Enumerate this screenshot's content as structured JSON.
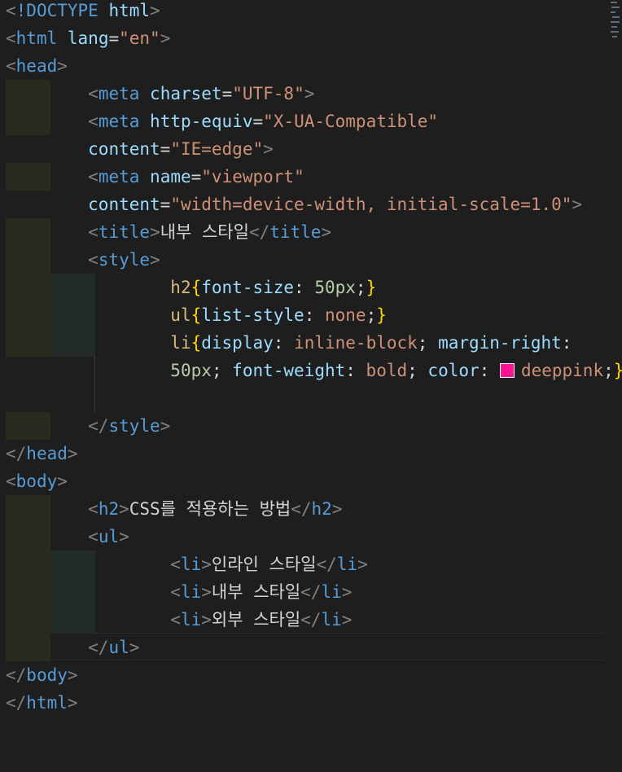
{
  "code": {
    "doctype": "!DOCTYPE",
    "tags": {
      "html": "html",
      "head": "head",
      "meta": "meta",
      "title": "title",
      "style": "style",
      "body": "body",
      "h2": "h2",
      "ul": "ul",
      "li": "li"
    },
    "attrs": {
      "lang": "lang",
      "charset": "charset",
      "http_equiv": "http-equiv",
      "content": "content",
      "name": "name"
    },
    "values": {
      "lang": "\"en\"",
      "charset": "\"UTF-8\"",
      "http_equiv": "\"X-UA-Compatible\"",
      "ie_edge": "\"IE=edge\"",
      "viewport": "\"viewport\"",
      "viewport_content": "\"width=device-width, initial-scale=1.0\""
    },
    "title_text": "내부 스타일",
    "css": {
      "h2": "h2",
      "ul": "ul",
      "li": "li",
      "font_size": "font-size",
      "v50px": "50px",
      "list_style": "list-style",
      "none": "none",
      "display": "display",
      "inline_block": "inline-block",
      "margin_right": "margin-right",
      "font_weight": "font-weight",
      "bold": "bold",
      "color": "color",
      "deeppink": "deeppink",
      "swatch_color": "#ff1493"
    },
    "h2_text": "CSS를 적용하는 방법",
    "list_items": [
      "인라인 스타일",
      "내부 스타일",
      "외부 스타일"
    ]
  }
}
